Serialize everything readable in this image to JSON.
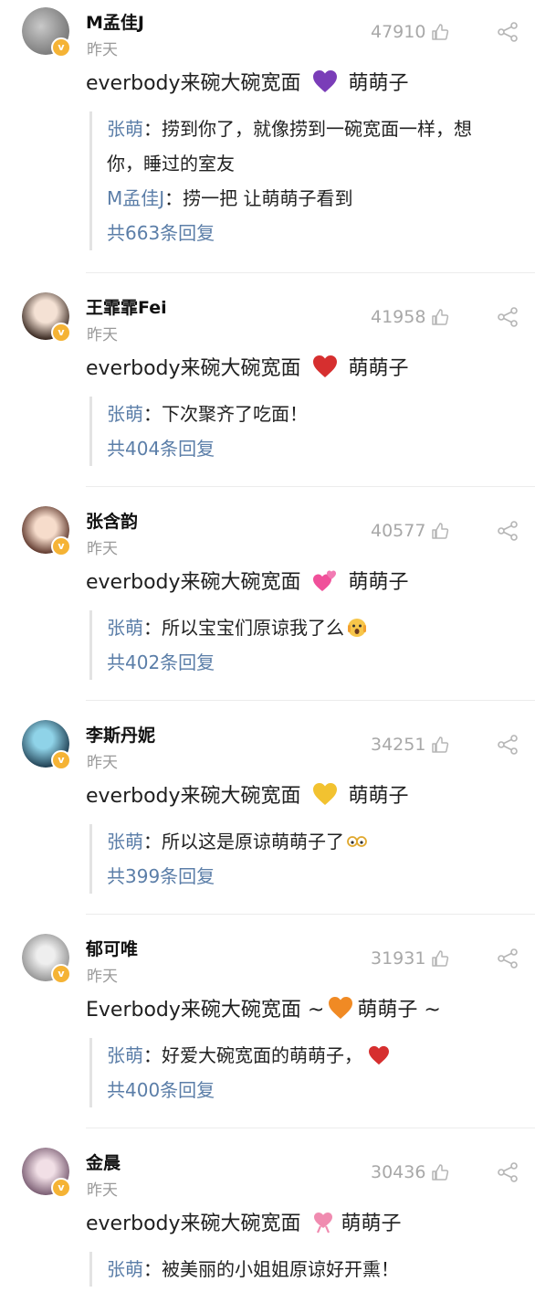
{
  "comments": [
    {
      "username": "M孟佳J",
      "time": "昨天",
      "likes": "47910",
      "text_before": "everbody来碗大碗宽面",
      "emoji": "purple-heart",
      "emoji_color": "#7a3db8",
      "text_after": "萌萌子",
      "replies": [
        {
          "name": "张萌",
          "text": "：捞到你了，就像捞到一碗宽面一样，想你，睡过的室友"
        },
        {
          "name": "M孟佳J",
          "text": "：捞一把 让萌萌子看到"
        }
      ],
      "more": "共663条回复"
    },
    {
      "username": "王霏霏Fei",
      "time": "昨天",
      "likes": "41958",
      "text_before": "everbody来碗大碗宽面",
      "emoji": "red-heart",
      "emoji_color": "#d62f2f",
      "text_after": "萌萌子",
      "replies": [
        {
          "name": "张萌",
          "text": "：下次聚齐了吃面！"
        }
      ],
      "more": "共404条回复"
    },
    {
      "username": "张含韵",
      "time": "昨天",
      "likes": "40577",
      "text_before": "everbody来碗大碗宽面",
      "emoji": "two-hearts",
      "emoji_color": "#f0509a",
      "text_after": "萌萌子",
      "replies": [
        {
          "name": "张萌",
          "text": "：所以宝宝们原谅我了么"
        }
      ],
      "more": "共402条回复"
    },
    {
      "username": "李斯丹妮",
      "time": "昨天",
      "likes": "34251",
      "text_before": "everbody来碗大碗宽面",
      "emoji": "yellow-heart",
      "emoji_color": "#f2c230",
      "text_after": "萌萌子",
      "replies": [
        {
          "name": "张萌",
          "text": "：所以这是原谅萌萌子了"
        }
      ],
      "more": "共399条回复"
    },
    {
      "username": "郁可唯",
      "time": "昨天",
      "likes": "31931",
      "text_before": "Everbody来碗大碗宽面 ~",
      "emoji": "orange-heart",
      "emoji_color": "#f08a24",
      "text_after": "萌萌子 ~",
      "replies": [
        {
          "name": "张萌",
          "text": "：好爱大碗宽面的萌萌子，"
        }
      ],
      "more": "共400条回复"
    },
    {
      "username": "金晨",
      "time": "昨天",
      "likes": "30436",
      "text_before": "everbody来碗大碗宽面",
      "emoji": "heart-ribbon",
      "emoji_color": "#f08bb0",
      "text_after": "萌萌子",
      "replies": [
        {
          "name": "张萌",
          "text": "：被美丽的小姐姐原谅好开熏！"
        }
      ],
      "more": ""
    }
  ],
  "colors": {
    "link": "#5b7ea8",
    "muted": "#9a9a9a",
    "vip_badge": "#f5b335"
  }
}
